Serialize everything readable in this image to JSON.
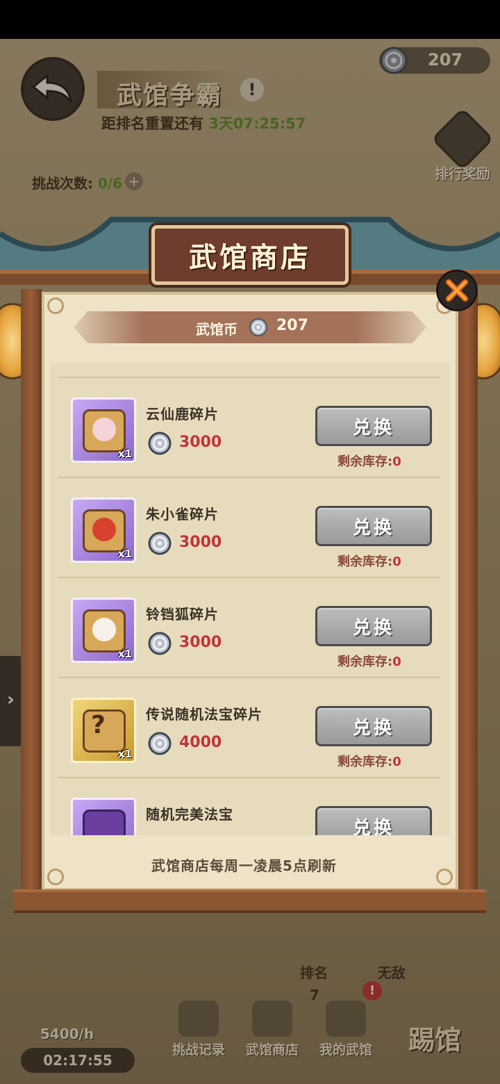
{
  "background": {
    "title": "武馆争霸",
    "reset_prefix": "距排名重置还有",
    "reset_time": "3天07:25:57",
    "coins": "207",
    "rank_reward_label": "排行奖励",
    "challenge_label": "挑战次数:",
    "challenge_value": "0/6"
  },
  "shop": {
    "title": "武馆商店",
    "currency_label": "武馆币",
    "currency_value": "207",
    "footer_note": "武馆商店每周一凌晨5点刷新",
    "exchange_label": "兑换",
    "stock_label": "剩余库存:",
    "items": [
      {
        "name": "云仙鹿碎片",
        "price": "3000",
        "qty": "x1",
        "stock": "0",
        "rarity": "purple",
        "face_color": "#f4d4d9"
      },
      {
        "name": "朱小雀碎片",
        "price": "3000",
        "qty": "x1",
        "stock": "0",
        "rarity": "purple",
        "face_color": "#d9412f"
      },
      {
        "name": "铃铛狐碎片",
        "price": "3000",
        "qty": "x1",
        "stock": "0",
        "rarity": "purple",
        "face_color": "#f8f1ea"
      },
      {
        "name": "传说随机法宝碎片",
        "price": "4000",
        "qty": "x1",
        "stock": "0",
        "rarity": "gold",
        "face_color": ""
      },
      {
        "name": "随机完美法宝",
        "price": "",
        "qty": "",
        "stock": "",
        "rarity": "purple",
        "face_color": ""
      }
    ]
  },
  "hud": {
    "income": "5400/h",
    "timer": "02:17:55",
    "challenge_record": "挑战记录",
    "shop_btn": "武馆商店",
    "my_hall": "我的武馆",
    "rank_label": "排名",
    "rank_value": "7",
    "unbeaten_label": "无敌",
    "kick_label": "踢馆",
    "alert": "!"
  },
  "colors": {
    "price_red": "#c0343a",
    "accent_green": "#5a8c2a",
    "header_brown": "#6e3d2d"
  }
}
